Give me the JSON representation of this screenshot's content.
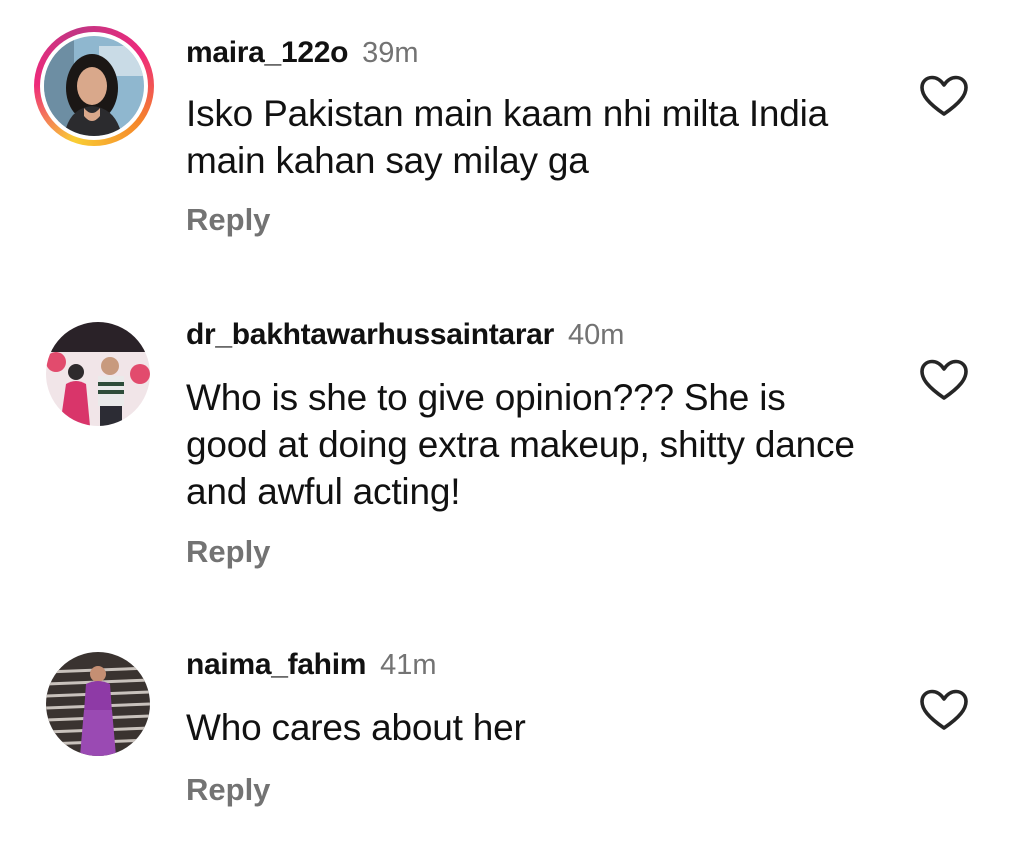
{
  "comments": [
    {
      "username": "maira_122o",
      "time": "39m",
      "text": "Isko Pakistan main kaam nhi milta India main kahan say milay ga",
      "reply_label": "Reply",
      "like_icon": "heart-outline-icon",
      "has_story_ring": true
    },
    {
      "username": "dr_bakhtawarhussaintarar",
      "time": "40m",
      "text": "Who is she to give opinion??? She is good at doing extra makeup, shitty dance and awful acting!",
      "reply_label": "Reply",
      "like_icon": "heart-outline-icon",
      "has_story_ring": false
    },
    {
      "username": "naima_fahim",
      "time": "41m",
      "text": "Who cares about her",
      "reply_label": "Reply",
      "like_icon": "heart-outline-icon",
      "has_story_ring": false
    }
  ],
  "colors": {
    "text": "#111111",
    "secondary": "#737373",
    "background": "#ffffff",
    "story_ring": [
      "#f9ce34",
      "#ee2a7b",
      "#c13584"
    ]
  }
}
